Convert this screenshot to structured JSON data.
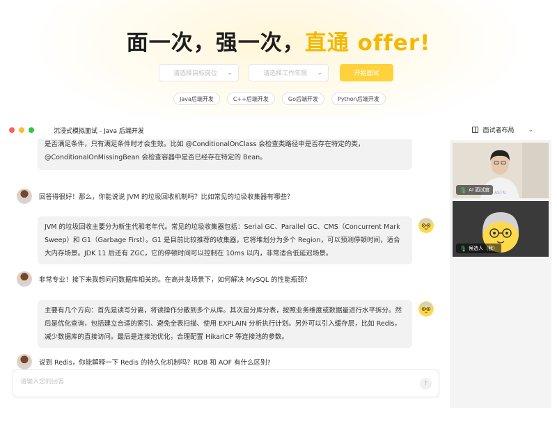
{
  "hero": {
    "headline_main": "面一次，强一次，",
    "headline_accent": "直通 offer!",
    "role_select_placeholder": "请选择目标岗位",
    "years_select_placeholder": "请选择工作年限",
    "start_button": "开始面试",
    "tags": [
      "Java后端开发",
      "C++后端开发",
      "Go后端开发",
      "Python后端开发"
    ],
    "accent_color": "#f5b800",
    "button_color": "#ffd23c"
  },
  "window": {
    "title": "沉浸式模拟面试 - Java 后端开发",
    "layout_label": "面试者布局"
  },
  "chat": {
    "messages": [
      {
        "role": "candidate",
        "text": "是否满足条件，只有满足条件时才会生效。比如 @ConditionalOnClass 会检查类路径中是否存在特定的类，@ConditionalOnMissingBean 会检查容器中是否已经存在特定的 Bean。"
      },
      {
        "role": "interviewer",
        "text": "回答得很好！那么，你能说说 JVM 的垃圾回收机制吗？比如常见的垃圾收集器有哪些？"
      },
      {
        "role": "candidate",
        "text": "JVM 的垃圾回收主要分为新生代和老年代。常见的垃圾收集器包括：Serial GC、Parallel GC、CMS（Concurrent Mark Sweep）和 G1（Garbage First）。G1 是目前比较推荐的收集器，它将堆划分为多个 Region，可以预测停顿时间，适合大内存场景。JDK 11 后还有 ZGC，它的停顿时间可以控制在 10ms 以内，非常适合低延迟场景。"
      },
      {
        "role": "interviewer",
        "text": "非常专业！接下来我想问问数据库相关的。在高并发场景下，如何解决 MySQL 的性能瓶颈？"
      },
      {
        "role": "candidate",
        "text": "主要有几个方向：首先是读写分离，将读操作分散到多个从库。其次是分库分表，按照业务维度或数据量进行水平拆分。然后是优化查询，包括建立合适的索引、避免全表扫描、使用 EXPLAIN 分析执行计划。另外可以引入缓存层，比如 Redis，减少数据库的直接访问。最后是连接池优化，合理配置 HikariCP 等连接池的参数。"
      },
      {
        "role": "interviewer",
        "text": "说到 Redis，你能解释一下 Redis 的持久化机制吗？RDB 和 AOF 有什么区别?"
      }
    ],
    "input_placeholder": "请输入您的回答",
    "send_icon": "send-icon"
  },
  "videos": {
    "interviewer_label": "AI 面试官",
    "candidate_label": "候选人（我）"
  }
}
